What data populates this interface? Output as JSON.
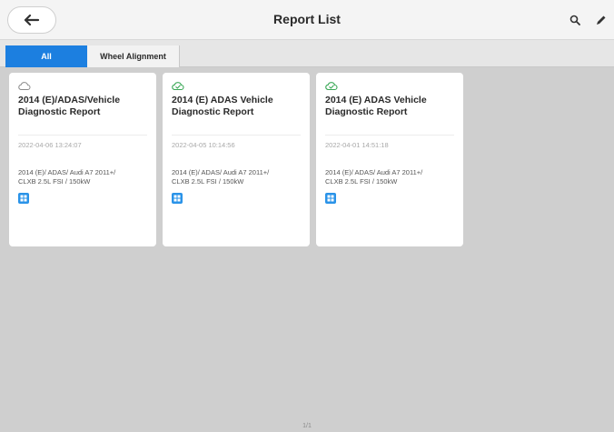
{
  "header": {
    "title": "Report List",
    "back_icon": "arrow-left-icon",
    "search_icon": "search-icon",
    "edit_icon": "pencil-icon"
  },
  "tabs": [
    {
      "label": "All",
      "selected": true
    },
    {
      "label": "Wheel Alignment",
      "selected": false
    }
  ],
  "cards": [
    {
      "cloud_icon": "cloud-outline-icon",
      "cloud_synced": false,
      "title_line1": "2014 (E)/ADAS/Vehicle",
      "title_line2": "Diagnostic Report",
      "date": "2022-04-06 13:24:07",
      "vehicle_line1": "2014 (E)/ ADAS/ Audi A7 2011+/",
      "vehicle_line2": "CLXB 2.5L FSI /  150kW",
      "report_icon": "report-file-icon"
    },
    {
      "cloud_icon": "cloud-check-icon",
      "cloud_synced": true,
      "title_line1": "2014 (E) ADAS Vehicle",
      "title_line2": "Diagnostic Report",
      "date": "2022-04-05 10:14:56",
      "vehicle_line1": "2014 (E)/ ADAS/ Audi A7 2011+/",
      "vehicle_line2": "CLXB 2.5L FSI /  150kW",
      "report_icon": "report-file-icon"
    },
    {
      "cloud_icon": "cloud-check-icon",
      "cloud_synced": true,
      "title_line1": "2014 (E) ADAS Vehicle",
      "title_line2": "Diagnostic Report",
      "date": "2022-04-01 14:51:18",
      "vehicle_line1": "2014 (E)/ ADAS/ Audi A7 2011+/",
      "vehicle_line2": "CLXB 2.5L FSI /  150kW",
      "report_icon": "report-file-icon"
    }
  ],
  "pagination": "1/1",
  "colors": {
    "accent": "#1c7fe0",
    "synced": "#3aa856",
    "unsynced": "#8a8a8a",
    "report_icon": "#2a93e8"
  }
}
